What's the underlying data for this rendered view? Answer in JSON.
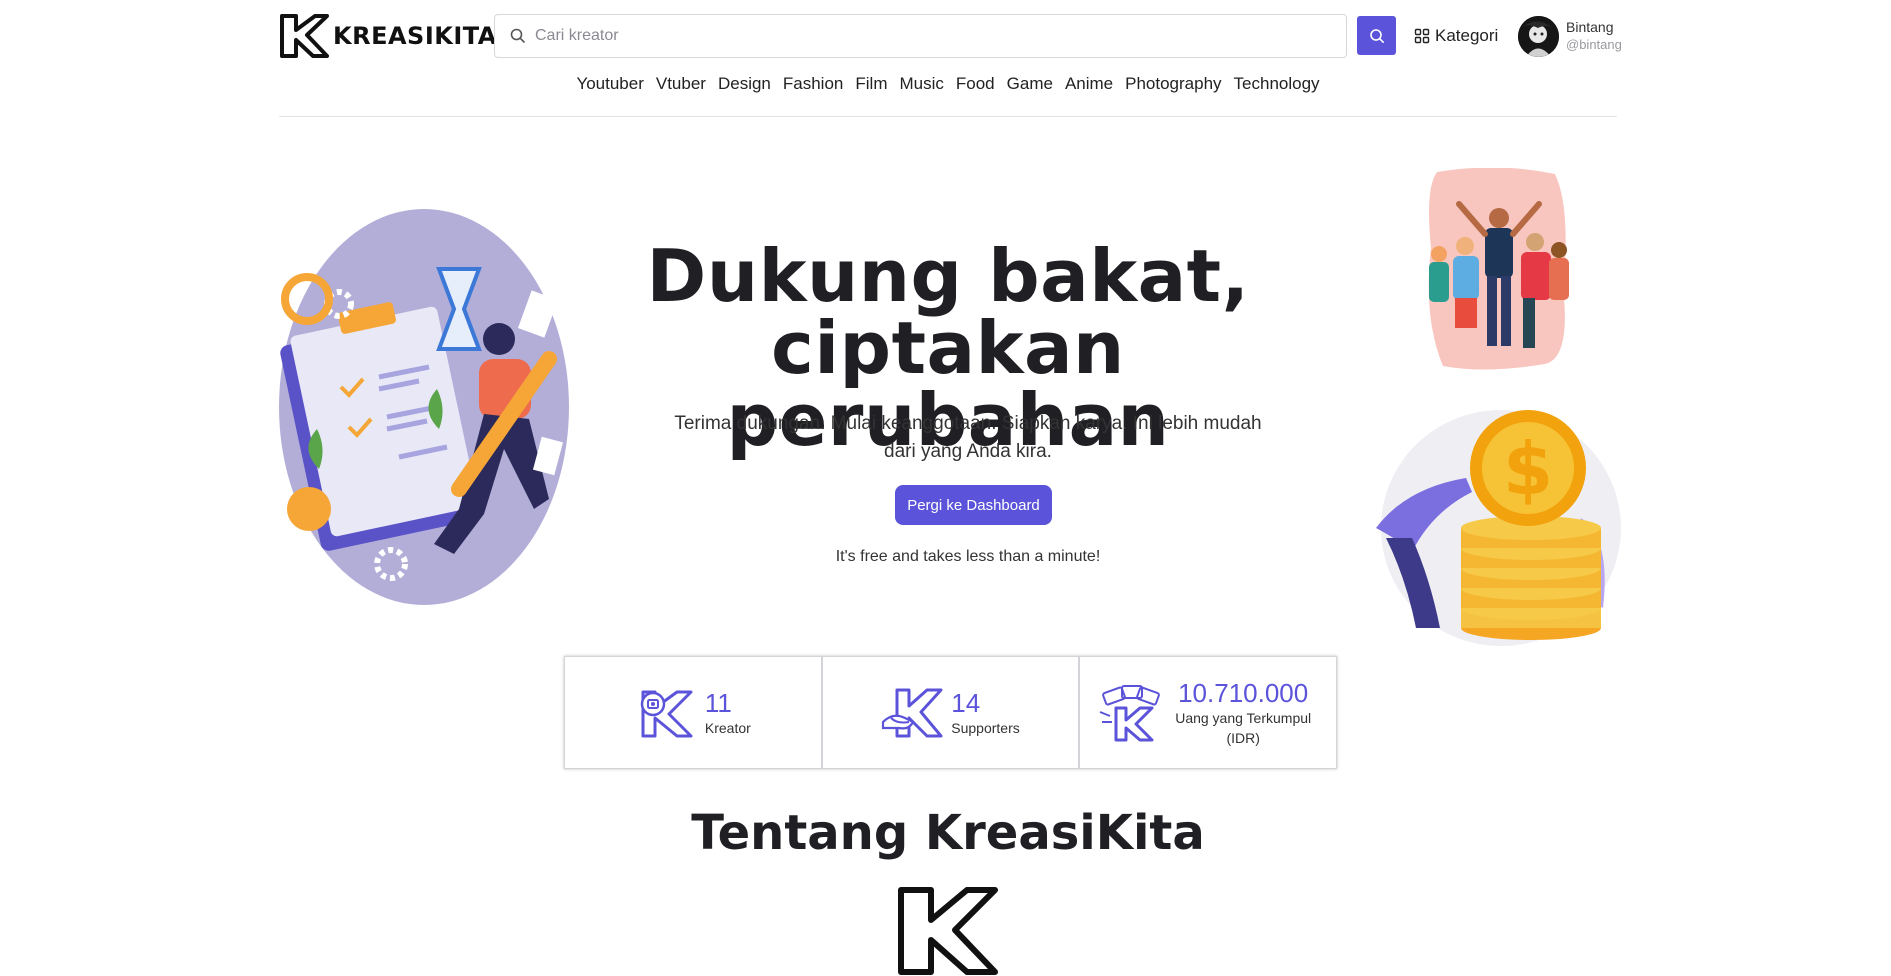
{
  "header": {
    "logo_text": "KREASIKITA",
    "search_placeholder": "Cari kreator",
    "kategori_label": "Kategori",
    "user_name": "Bintang",
    "user_handle": "@bintang"
  },
  "nav": {
    "items": [
      "Youtuber",
      "Vtuber",
      "Design",
      "Fashion",
      "Film",
      "Music",
      "Food",
      "Game",
      "Anime",
      "Photography",
      "Technology"
    ]
  },
  "hero": {
    "title_line1": "Dukung bakat,",
    "title_line2": "ciptakan perubahan",
    "subtitle": "Terima dukungan. Mulai keanggotaan. Siapkan karya. Ini lebih mudah dari yang Anda kira.",
    "button_label": "Pergi ke Dashboard",
    "note": "It's free and takes less than a minute!"
  },
  "stats": [
    {
      "value": "11",
      "label": "Kreator",
      "icon": "creator-k-icon"
    },
    {
      "value": "14",
      "label": "Supporters",
      "icon": "supporter-k-icon"
    },
    {
      "value": "10.710.000",
      "label": "Uang yang Terkumpul (IDR)",
      "icon": "money-k-icon"
    }
  ],
  "about": {
    "title": "Tentang KreasiKita"
  },
  "colors": {
    "accent": "#5b53d9",
    "text_dark": "#1f1f24",
    "border": "#d4d4d8"
  }
}
